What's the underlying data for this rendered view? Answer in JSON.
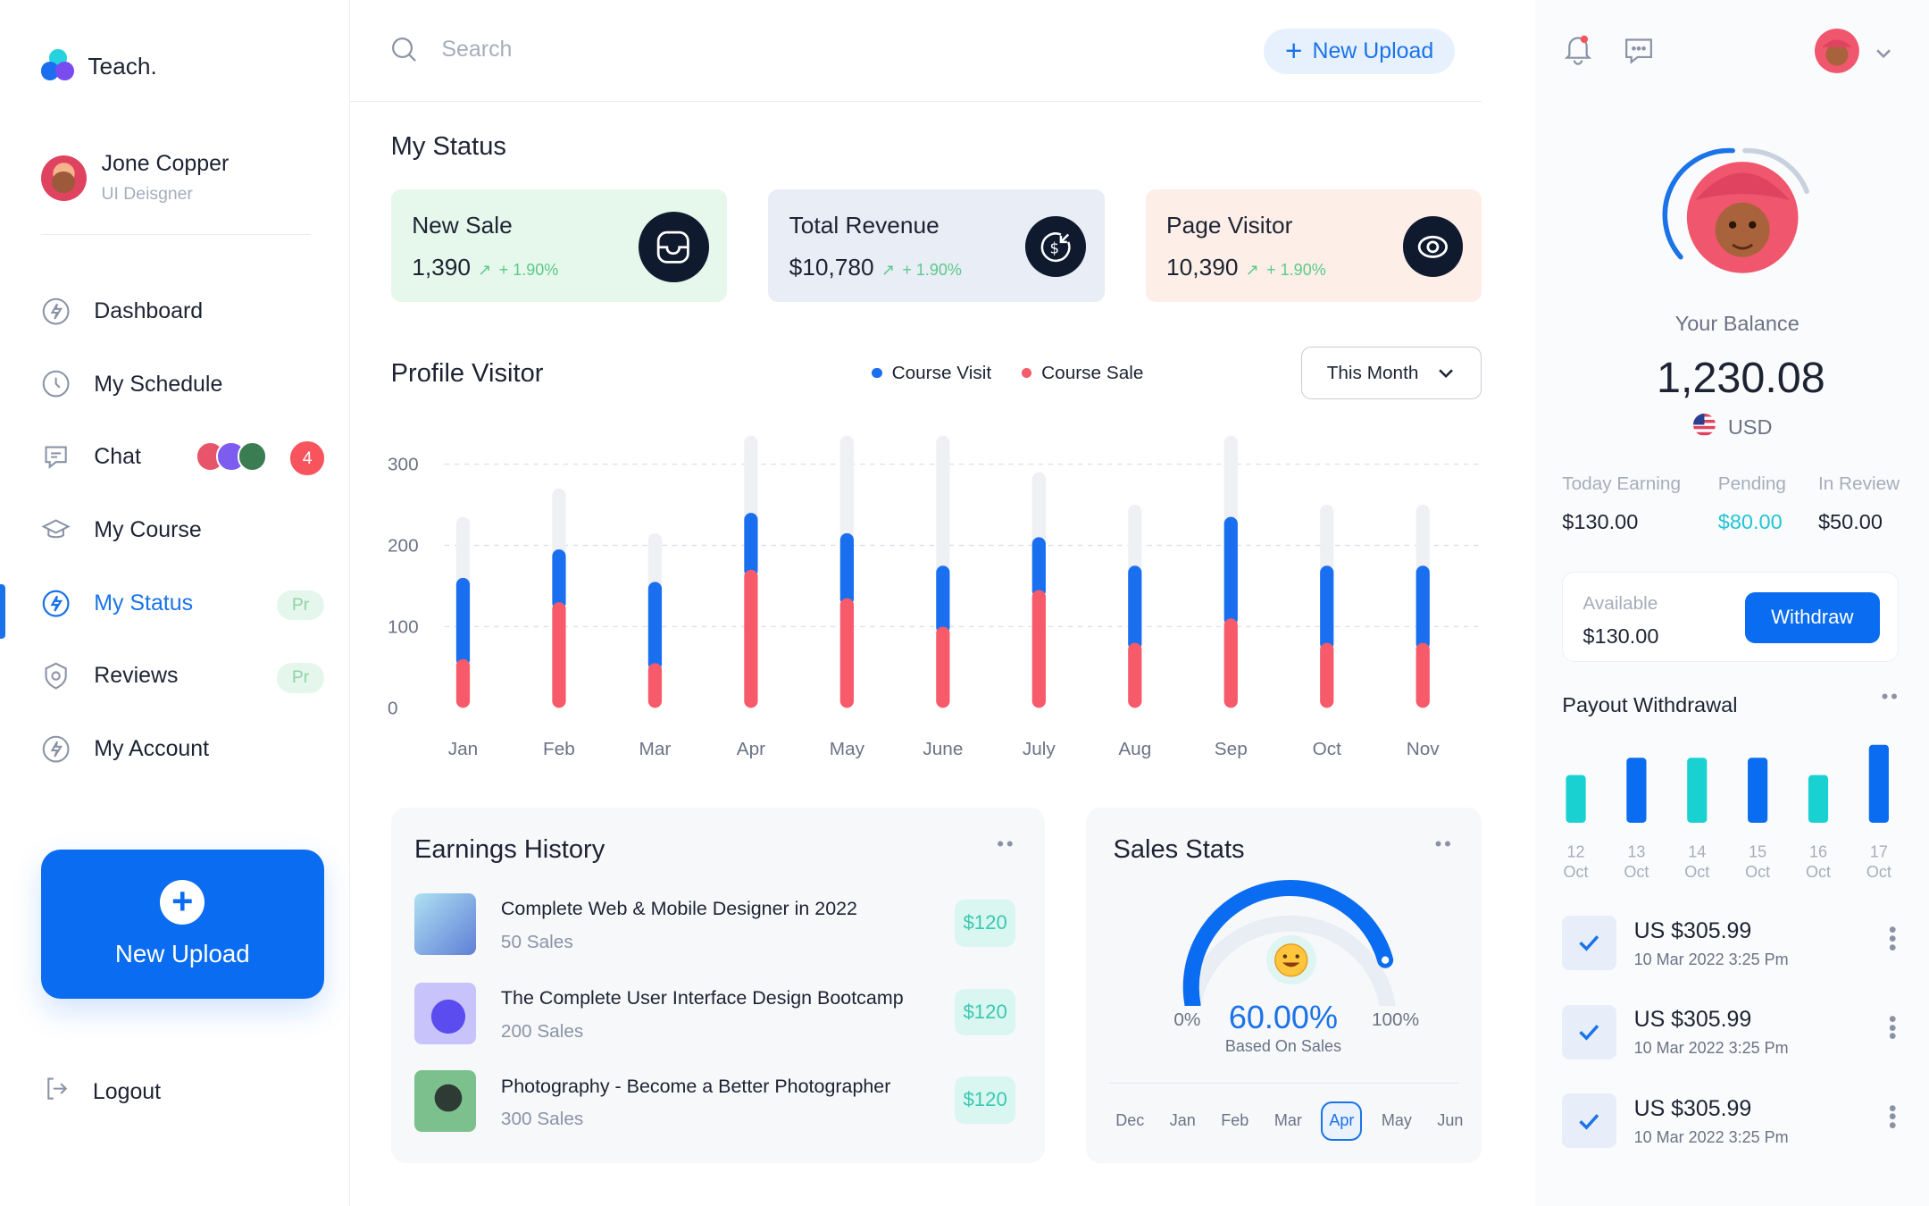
{
  "brand": {
    "name": "Teach."
  },
  "profile": {
    "name": "Jone Copper",
    "role": "UI Deisgner"
  },
  "nav": [
    {
      "label": "Dashboard",
      "icon": "dashboard-icon"
    },
    {
      "label": "My Schedule",
      "icon": "clock-icon"
    },
    {
      "label": "Chat",
      "icon": "chat-icon",
      "count": "4"
    },
    {
      "label": "My Course",
      "icon": "graduation-cap-icon"
    },
    {
      "label": "My Status",
      "icon": "status-icon",
      "badge": "Pr",
      "active": true
    },
    {
      "label": "Reviews",
      "icon": "reviews-icon",
      "badge": "Pr"
    },
    {
      "label": "My Account",
      "icon": "account-icon"
    }
  ],
  "sidebar_upload": {
    "label": "New Upload"
  },
  "logout": {
    "label": "Logout"
  },
  "search": {
    "placeholder": "Search"
  },
  "topbar": {
    "upload_label": "New Upload"
  },
  "status": {
    "title": "My Status",
    "cards": [
      {
        "title": "New Sale",
        "value": "1,390",
        "change": "+ 1.90%",
        "bg": "#e6f8ec",
        "icon": "inbox-icon"
      },
      {
        "title": "Total Revenue",
        "value": "$10,780",
        "change": "+ 1.90%",
        "bg": "#e8edf6",
        "icon": "dollar-icon"
      },
      {
        "title": "Page Visitor",
        "value": "10,390",
        "change": "+ 1.90%",
        "bg": "#fdefe7",
        "icon": "eye-icon"
      }
    ]
  },
  "visitor": {
    "title": "Profile Visitor",
    "legend": [
      {
        "label": "Course Visit",
        "color": "#1a6ff0"
      },
      {
        "label": "Course Sale",
        "color": "#f75a68"
      }
    ],
    "range": "This Month"
  },
  "chart_data": {
    "type": "bar",
    "title": "Profile Visitor",
    "categories": [
      "Jan",
      "Feb",
      "Mar",
      "Apr",
      "May",
      "June",
      "July",
      "Aug",
      "Sep",
      "Oct",
      "Nov"
    ],
    "yticks": [
      "0",
      "100",
      "200",
      "300"
    ],
    "ylim": [
      0,
      300
    ],
    "stacked": true,
    "series": [
      {
        "name": "Course Sale",
        "color": "#f75a68",
        "values": [
          60,
          130,
          55,
          170,
          135,
          100,
          145,
          80,
          110,
          80,
          80
        ]
      },
      {
        "name": "Course Visit",
        "color": "#1a6ff0",
        "values": [
          100,
          65,
          100,
          70,
          80,
          75,
          65,
          95,
          125,
          95,
          95
        ]
      }
    ],
    "background_totals": [
      235,
      270,
      215,
      335,
      335,
      335,
      290,
      250,
      335,
      250,
      250
    ],
    "grid": true,
    "legend_position": "top-right"
  },
  "earnings": {
    "title": "Earnings History",
    "items": [
      {
        "name": "Complete Web & Mobile  Designer in 2022",
        "sales": "50 Sales",
        "price": "$120"
      },
      {
        "name": "The Complete User Interface Design Bootcamp",
        "sales": "200 Sales",
        "price": "$120"
      },
      {
        "name": "Photography - Become a  Better Photographer",
        "sales": "300 Sales",
        "price": "$120"
      }
    ]
  },
  "sales_stats": {
    "title": "Sales Stats",
    "value": "60.00%",
    "percent": 60,
    "sub": "Based On Sales",
    "min_label": "0%",
    "max_label": "100%",
    "months": [
      "Dec",
      "Jan",
      "Feb",
      "Mar",
      "Apr",
      "May",
      "Jun"
    ],
    "selected_month": "Apr"
  },
  "balance": {
    "label": "Your Balance",
    "value": "1,230.08",
    "currency": "USD",
    "stats": [
      {
        "label": "Today Earning",
        "value": "$130.00",
        "color": "#1d2333"
      },
      {
        "label": "Pending",
        "value": "$80.00",
        "color": "#22c4d6"
      },
      {
        "label": "In Review",
        "value": "$50.00",
        "color": "#1d2333"
      }
    ],
    "available_label": "Available",
    "available_value": "$130.00",
    "withdraw_label": "Withdraw"
  },
  "payout": {
    "title": "Payout Withdrawal",
    "bars": [
      {
        "day": "12",
        "month": "Oct",
        "value": 0.55,
        "color": "#1ad1d1"
      },
      {
        "day": "13",
        "month": "Oct",
        "value": 0.75,
        "color": "#0a6cf0"
      },
      {
        "day": "14",
        "month": "Oct",
        "value": 0.75,
        "color": "#1ad1d1"
      },
      {
        "day": "15",
        "month": "Oct",
        "value": 0.75,
        "color": "#0a6cf0"
      },
      {
        "day": "16",
        "month": "Oct",
        "value": 0.55,
        "color": "#1ad1d1"
      },
      {
        "day": "17",
        "month": "Oct",
        "value": 0.9,
        "color": "#0a6cf0"
      }
    ]
  },
  "transactions": [
    {
      "amount": "US $305.99",
      "date": "10 Mar 2022 3:25 Pm"
    },
    {
      "amount": "US $305.99",
      "date": "10 Mar 2022 3:25 Pm"
    },
    {
      "amount": "US $305.99",
      "date": "10 Mar 2022 3:25 Pm"
    }
  ]
}
